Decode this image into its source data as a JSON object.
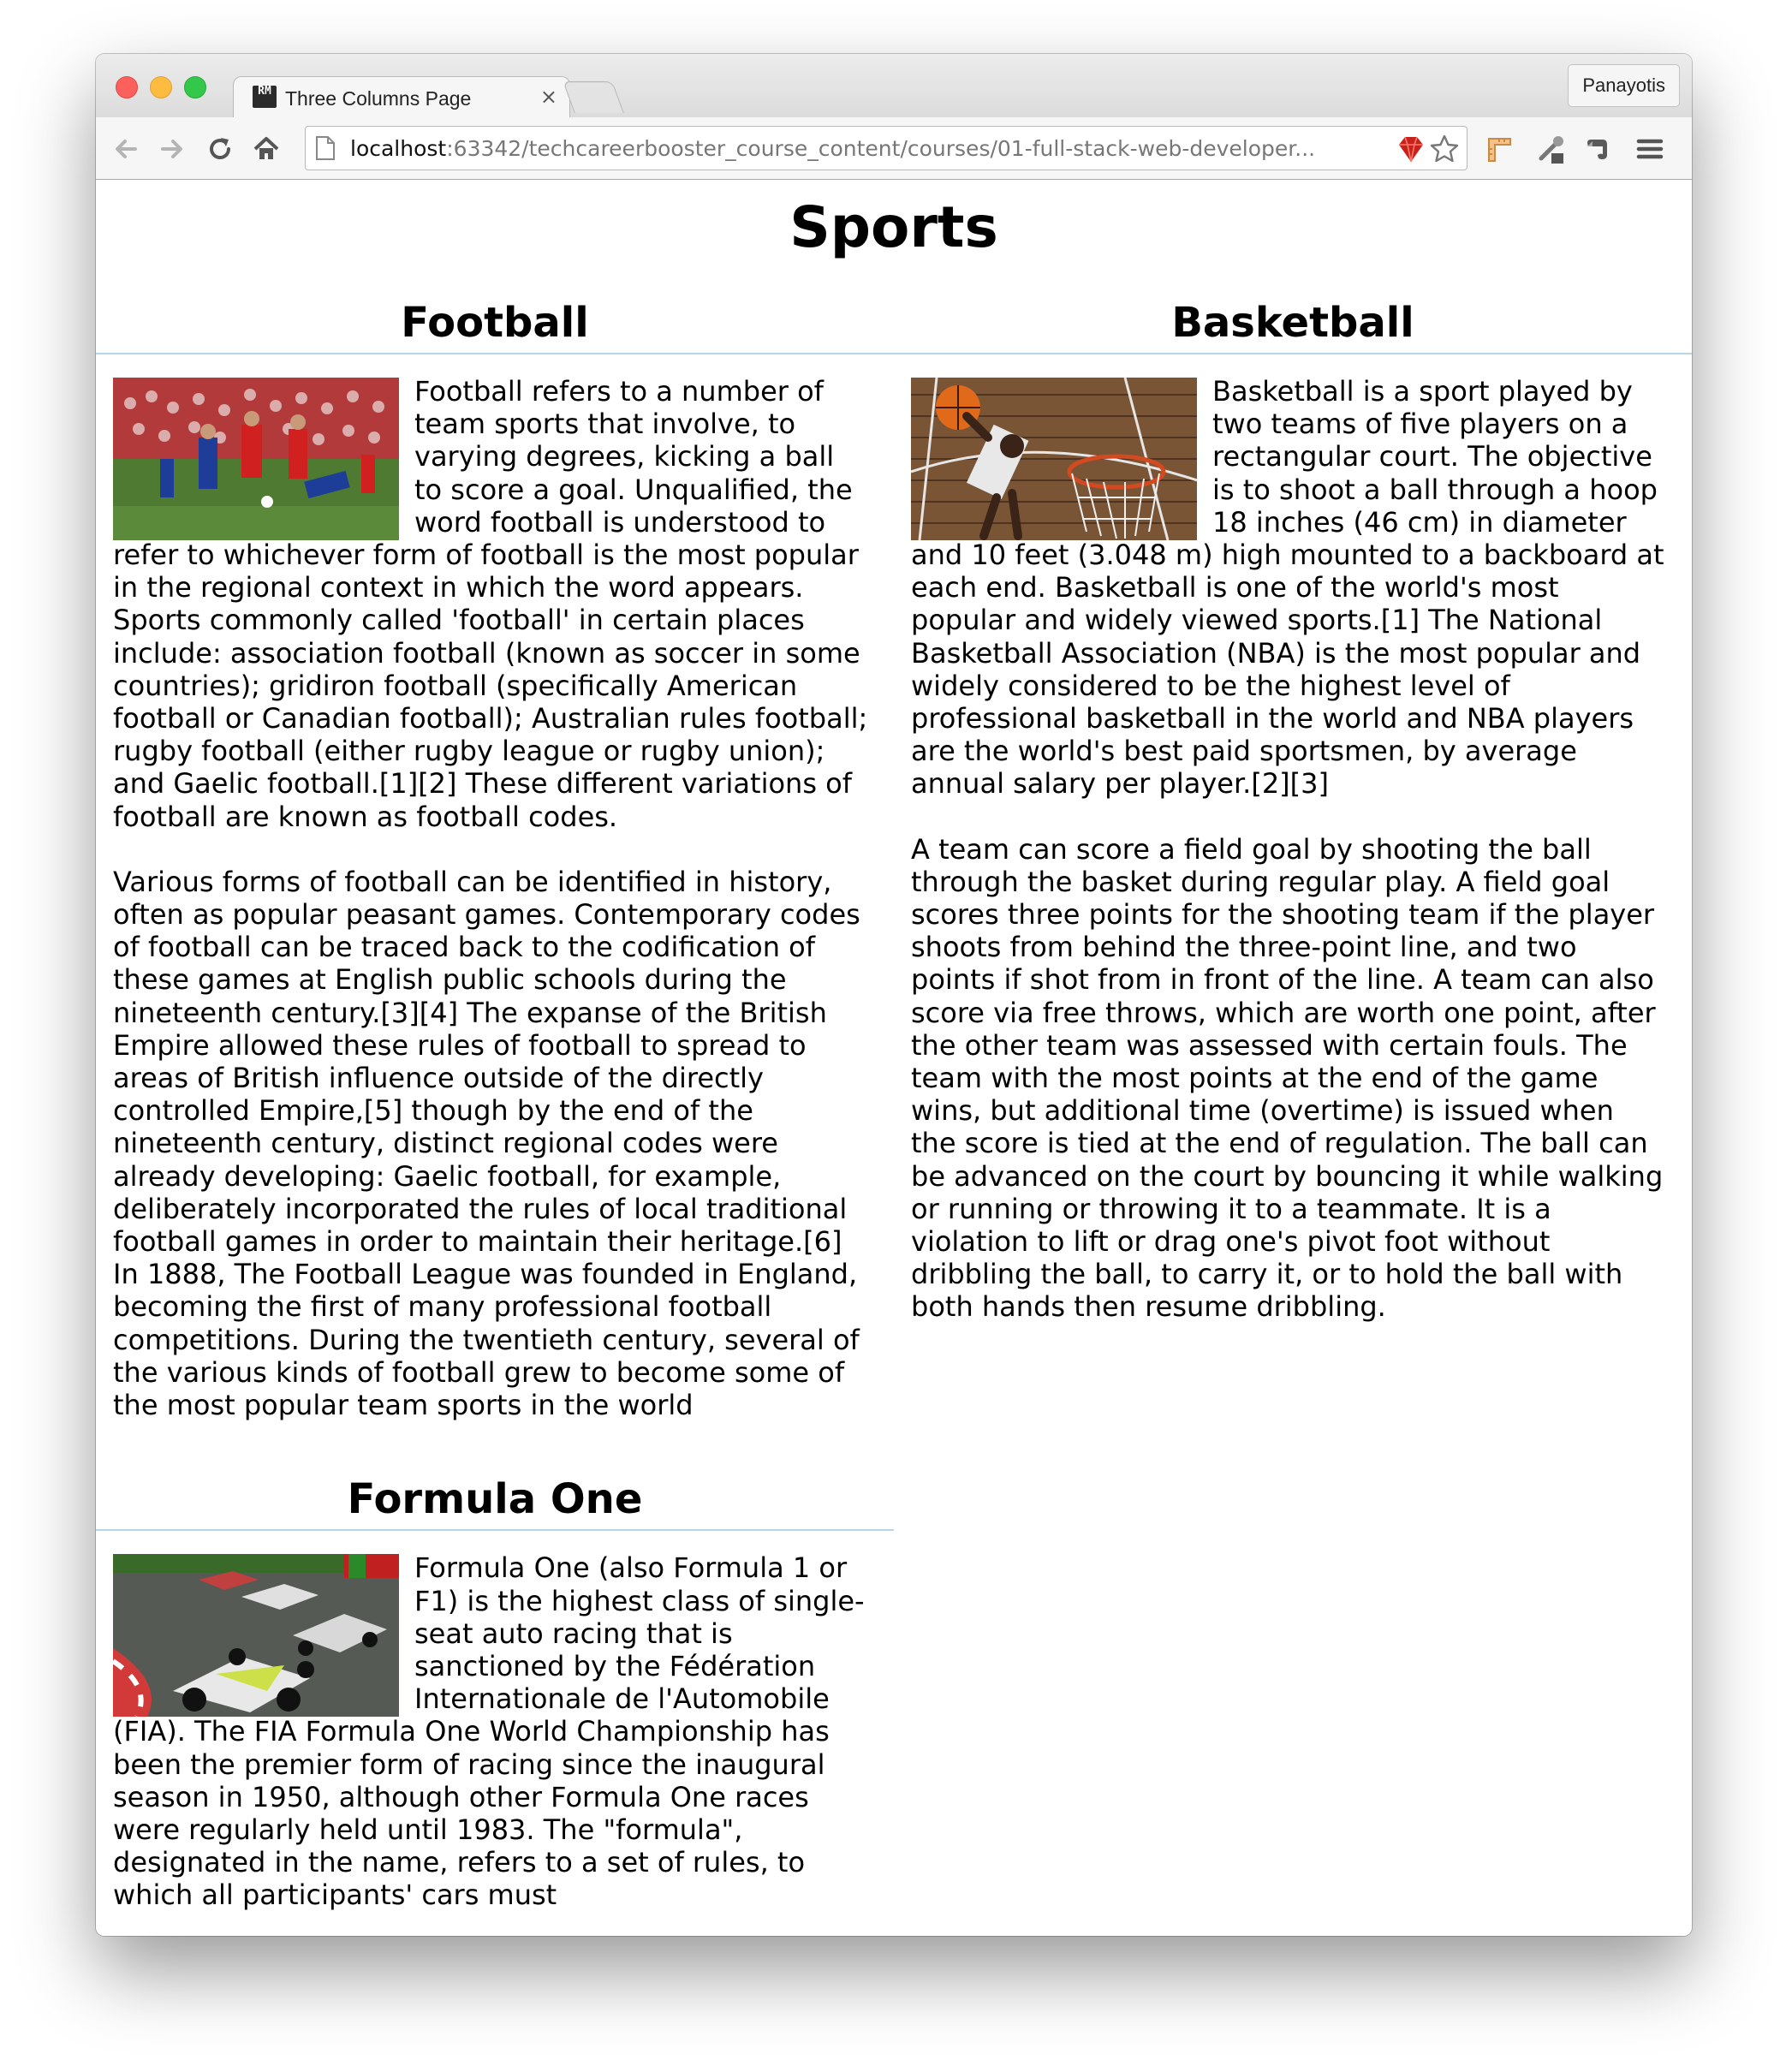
{
  "browser": {
    "tab_title": "Three Columns Page",
    "tab_favicon_text": "RM",
    "tab_close": "×",
    "profile_name": "Panayotis",
    "url_host": "localhost",
    "url_path": ":63342/techcareerbooster_course_content/courses/01-full-stack-web-developer..."
  },
  "icons": {
    "back": "back-arrow-icon",
    "forward": "forward-arrow-icon",
    "reload": "reload-icon",
    "home": "home-icon",
    "page": "page-icon",
    "extension_ruby": "ruby-extension-icon",
    "bookmark": "star-icon",
    "ext_1": "ruler-extension-icon",
    "ext_2": "eyedropper-extension-icon",
    "ext_3": "evernote-icon",
    "menu": "hamburger-menu-icon"
  },
  "page": {
    "title": "Sports",
    "sections": {
      "football": {
        "heading": "Football",
        "paragraphs": [
          "Football refers to a number of team sports that involve, to varying degrees, kicking a ball to score a goal. Unqualified, the word football is understood to refer to whichever form of football is the most popular in the regional context in which the word appears. Sports commonly called 'football' in certain places include: association football (known as soccer in some countries); gridiron football (specifically American football or Canadian football); Australian rules football; rugby football (either rugby league or rugby union); and Gaelic football.[1][2] These different variations of football are known as football codes.",
          "Various forms of football can be identified in history, often as popular peasant games. Contemporary codes of football can be traced back to the codification of these games at English public schools during the nineteenth century.[3][4] The expanse of the British Empire allowed these rules of football to spread to areas of British influence outside of the directly controlled Empire,[5] though by the end of the nineteenth century, distinct regional codes were already developing: Gaelic football, for example, deliberately incorporated the rules of local traditional football games in order to maintain their heritage.[6] In 1888, The Football League was founded in England, becoming the first of many professional football competitions. During the twentieth century, several of the various kinds of football grew to become some of the most popular team sports in the world"
        ]
      },
      "formula_one": {
        "heading": "Formula One",
        "paragraphs": [
          "Formula One (also Formula 1 or F1) is the highest class of single-seat auto racing that is sanctioned by the Fédération Internationale de l'Automobile (FIA). The FIA Formula One World Championship has been the premier form of racing since the inaugural season in 1950, although other Formula One races were regularly held until 1983. The \"formula\", designated in the name, refers to a set of rules, to which all participants' cars must"
        ]
      },
      "basketball": {
        "heading": "Basketball",
        "paragraphs": [
          "Basketball is a sport played by two teams of five players on a rectangular court. The objective is to shoot a ball through a hoop 18 inches (46 cm) in diameter and 10 feet (3.048 m) high mounted to a backboard at each end. Basketball is one of the world's most popular and widely viewed sports.[1] The National Basketball Association (NBA) is the most popular and widely considered to be the highest level of professional basketball in the world and NBA players are the world's best paid sportsmen, by average annual salary per player.[2][3]",
          "A team can score a field goal by shooting the ball through the basket during regular play. A field goal scores three points for the shooting team if the player shoots from behind the three-point line, and two points if shot from in front of the line. A team can also score via free throws, which are worth one point, after the other team was assessed with certain fouls. The team with the most points at the end of the game wins, but additional time (overtime) is issued when the score is tied at the end of regulation. The ball can be advanced on the court by bouncing it while walking or running or throwing it to a teammate. It is a violation to lift or drag one's pivot foot without dribbling the ball, to carry it, or to hold the ball with both hands then resume dribbling."
        ]
      }
    }
  }
}
